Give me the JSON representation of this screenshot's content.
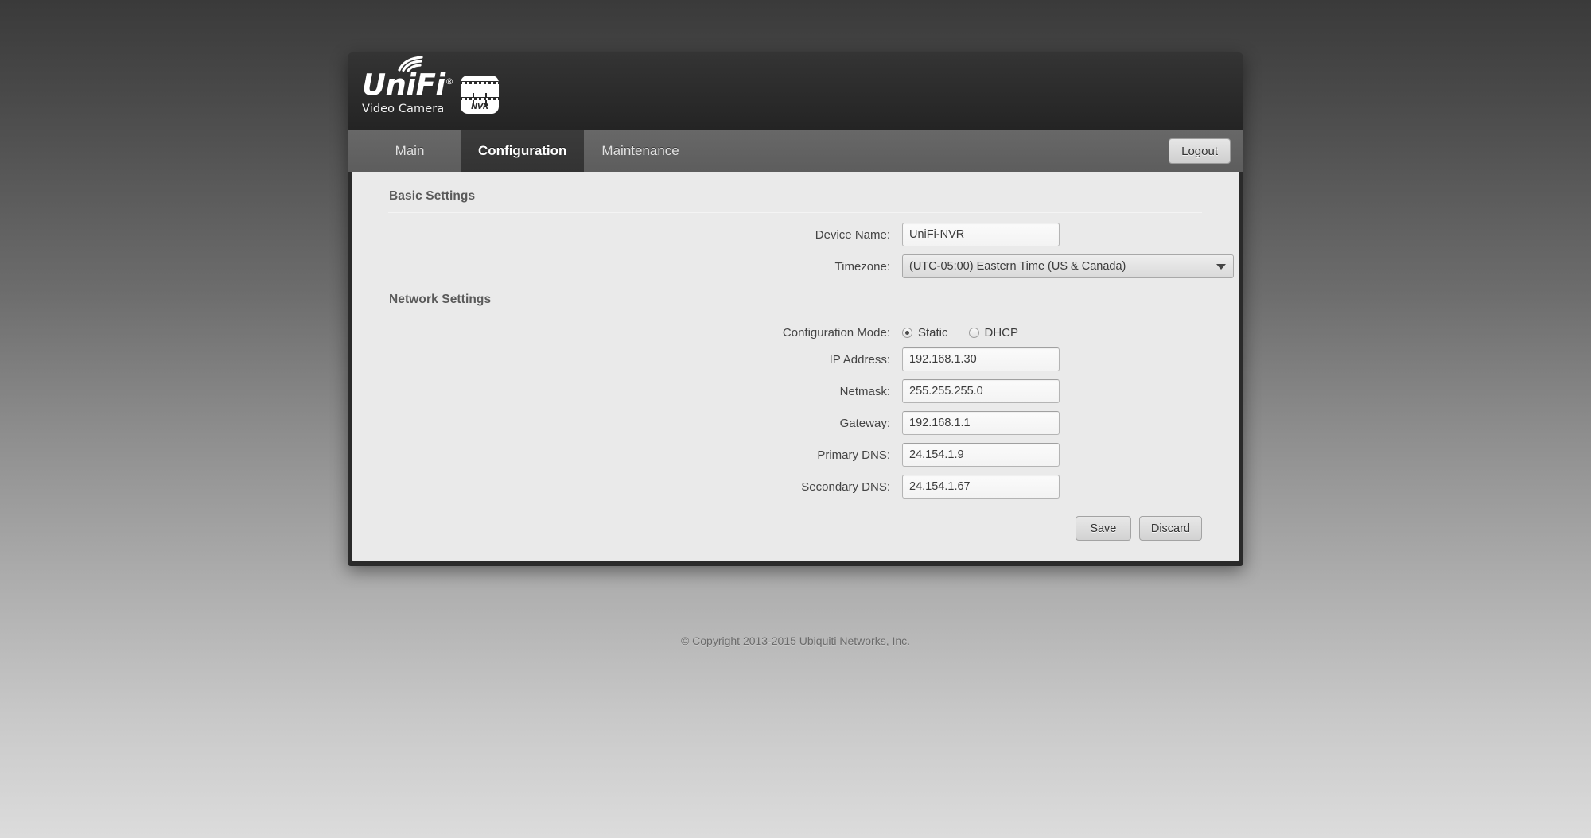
{
  "brand": {
    "name": "UniFi",
    "registered": "®",
    "subtitle": "Video Camera",
    "device_badge": "NVR"
  },
  "tabs": [
    {
      "label": "Main",
      "active": false
    },
    {
      "label": "Configuration",
      "active": true
    },
    {
      "label": "Maintenance",
      "active": false
    }
  ],
  "header": {
    "logout_label": "Logout"
  },
  "sections": {
    "basic": {
      "title": "Basic Settings",
      "fields": [
        {
          "label": "Device Name:",
          "value": "UniFi-NVR",
          "type": "text"
        }
      ],
      "timezone": {
        "label": "Timezone:",
        "value": "(UTC-05:00) Eastern Time (US & Canada)"
      }
    },
    "network": {
      "title": "Network Settings",
      "config_mode": {
        "label": "Configuration Mode:",
        "options": [
          {
            "label": "Static",
            "selected": true
          },
          {
            "label": "DHCP",
            "selected": false
          }
        ]
      },
      "fields": [
        {
          "label": "IP Address:",
          "value": "192.168.1.30"
        },
        {
          "label": "Netmask:",
          "value": "255.255.255.0"
        },
        {
          "label": "Gateway:",
          "value": "192.168.1.1"
        },
        {
          "label": "Primary DNS:",
          "value": "24.154.1.9"
        },
        {
          "label": "Secondary DNS:",
          "value": "24.154.1.67"
        }
      ]
    }
  },
  "actions": {
    "save_label": "Save",
    "discard_label": "Discard"
  },
  "footer": {
    "copyright": "© Copyright 2013-2015 Ubiquiti Networks, Inc."
  },
  "colors": {
    "panel_dark": "#2a2a2a",
    "tabbar": "#606060",
    "content_bg": "#eaeaea",
    "active_tab": "#363636"
  }
}
